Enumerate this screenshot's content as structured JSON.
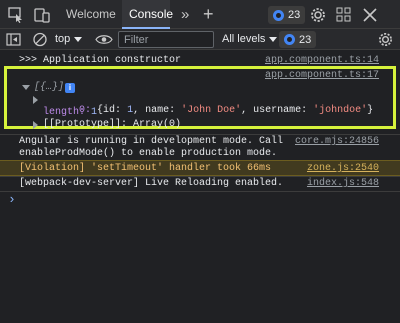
{
  "tabs": {
    "welcome": "Welcome",
    "console": "Console",
    "more": "»",
    "add": "+"
  },
  "tabbar": {
    "issues_count": "23"
  },
  "toolbar": {
    "context": "top",
    "filter_placeholder": "Filter",
    "levels": "All levels",
    "issues_count": "23"
  },
  "console": {
    "lines": {
      "app_constructor": ">>> Application constructor",
      "app_constructor_src": "app.component.ts:14",
      "obj_src": "app.component.ts:17",
      "obj_summary": "[{…}]",
      "item_index": "0:",
      "item_open": "{id: ",
      "item_id": "1",
      "item_name_key": ", name: ",
      "item_name": "'John Doe'",
      "item_user_key": ", username: ",
      "item_user": "'johndoe'",
      "item_close": "}",
      "length_key": "length:",
      "length_val": "1",
      "prototype": "[[Prototype]]: Array(0)",
      "angular_1": "Angular is running in development mode. Call",
      "angular_2": "enableProdMode() to enable production mode.",
      "angular_src": "core.mjs:24856",
      "violation": "[Violation] 'setTimeout' handler took 66ms",
      "violation_src": "zone.js:2540",
      "wds": "[webpack-dev-server] Live Reloading enabled.",
      "wds_src": "index.js:548",
      "prompt": "›"
    }
  },
  "colors": {
    "accent": "#8ab4f8",
    "highlight": "#d6f23c",
    "warning_bg": "#413a1f"
  }
}
